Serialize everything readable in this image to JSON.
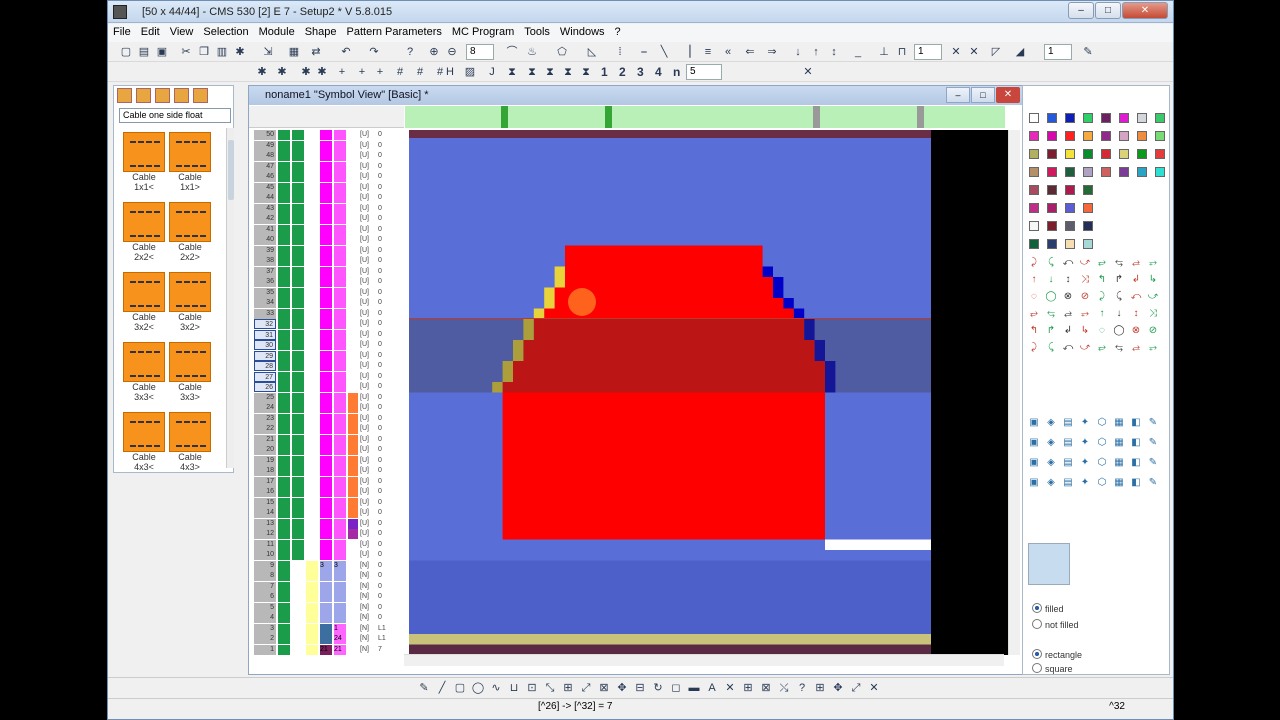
{
  "window": {
    "title": "[50 x 44/44] - CMS 530 [2] E 7 - Setup2 *    V 5.8.015",
    "min": "–",
    "max": "□",
    "close": "✕"
  },
  "menu": [
    "File",
    "Edit",
    "View",
    "Selection",
    "Module",
    "Shape",
    "Pattern Parameters",
    "MC Program",
    "Tools",
    "Windows",
    "?"
  ],
  "toolbar1": {
    "zoom": "8",
    "num": "1"
  },
  "toolbar2": {
    "labels": [
      "1",
      "2",
      "3",
      "4",
      "n"
    ],
    "num": "5"
  },
  "leftpanel": {
    "combo": "Cable one side float",
    "cables": [
      "Cable 1x1<",
      "Cable 1x1>",
      "Cable 2x2<",
      "Cable 2x2>",
      "Cable 3x2<",
      "Cable 3x2>",
      "Cable 3x3<",
      "Cable 3x3>",
      "Cable 4x3<",
      "Cable 4x3>"
    ]
  },
  "doc": {
    "title": "noname1 \"Symbol View\" [Basic] *",
    "ruler_marks": [
      "3",
      "2",
      "1",
      "0"
    ]
  },
  "rows": [
    {
      "n": "50",
      "t": "[U]",
      "z": "0"
    },
    {
      "n": "49",
      "t": "[U]",
      "z": "0"
    },
    {
      "n": "48",
      "t": "[U]",
      "z": "0"
    },
    {
      "n": "47",
      "t": "[U]",
      "z": "0"
    },
    {
      "n": "46",
      "t": "[U]",
      "z": "0"
    },
    {
      "n": "45",
      "t": "[U]",
      "z": "0"
    },
    {
      "n": "44",
      "t": "[U]",
      "z": "0"
    },
    {
      "n": "43",
      "t": "[U]",
      "z": "0"
    },
    {
      "n": "42",
      "t": "[U]",
      "z": "0"
    },
    {
      "n": "41",
      "t": "[U]",
      "z": "0"
    },
    {
      "n": "40",
      "t": "[U]",
      "z": "0"
    },
    {
      "n": "39",
      "t": "[U]",
      "z": "0"
    },
    {
      "n": "38",
      "t": "[U]",
      "z": "0"
    },
    {
      "n": "37",
      "t": "[U]",
      "z": "0"
    },
    {
      "n": "36",
      "t": "[U]",
      "z": "0"
    },
    {
      "n": "35",
      "t": "[U]",
      "z": "0"
    },
    {
      "n": "34",
      "t": "[U]",
      "z": "0"
    },
    {
      "n": "33",
      "t": "[U]",
      "z": "0"
    },
    {
      "n": "32",
      "t": "[U]",
      "z": "0"
    },
    {
      "n": "31",
      "t": "[U]",
      "z": "0"
    },
    {
      "n": "30",
      "t": "[U]",
      "z": "0"
    },
    {
      "n": "29",
      "t": "[U]",
      "z": "0"
    },
    {
      "n": "28",
      "t": "[U]",
      "z": "0"
    },
    {
      "n": "27",
      "t": "[U]",
      "z": "0"
    },
    {
      "n": "26",
      "t": "[U]",
      "z": "0"
    },
    {
      "n": "25",
      "t": "[U]",
      "z": "0"
    },
    {
      "n": "24",
      "t": "[U]",
      "z": "0"
    },
    {
      "n": "23",
      "t": "[U]",
      "z": "0"
    },
    {
      "n": "22",
      "t": "[U]",
      "z": "0"
    },
    {
      "n": "21",
      "t": "[U]",
      "z": "0"
    },
    {
      "n": "20",
      "t": "[U]",
      "z": "0"
    },
    {
      "n": "19",
      "t": "[U]",
      "z": "0"
    },
    {
      "n": "18",
      "t": "[U]",
      "z": "0"
    },
    {
      "n": "17",
      "t": "[U]",
      "z": "0"
    },
    {
      "n": "16",
      "t": "[U]",
      "z": "0"
    },
    {
      "n": "15",
      "t": "[U]",
      "z": "0"
    },
    {
      "n": "14",
      "t": "[U]",
      "z": "0"
    },
    {
      "n": "13",
      "t": "[U]",
      "z": "0"
    },
    {
      "n": "12",
      "t": "[U]",
      "z": "0"
    },
    {
      "n": "11",
      "t": "[U]",
      "z": "0"
    },
    {
      "n": "10",
      "t": "[U]",
      "z": "0"
    },
    {
      "n": "9",
      "t": "[N]",
      "z": "0"
    },
    {
      "n": "8",
      "t": "[N]",
      "z": "0"
    },
    {
      "n": "7",
      "t": "[N]",
      "z": "0"
    },
    {
      "n": "6",
      "t": "[N]",
      "z": "0"
    },
    {
      "n": "5",
      "t": "[N]",
      "z": "0"
    },
    {
      "n": "4",
      "t": "[N]",
      "z": "0"
    },
    {
      "n": "3",
      "t": "[N]",
      "z": "L1"
    },
    {
      "n": "2",
      "t": "[N]",
      "z": "L1"
    },
    {
      "n": "1",
      "t": "[N]",
      "z": "7"
    }
  ],
  "row_special": {
    "r3_c5": "1",
    "r2_c5": "24",
    "r1_c4": "21",
    "r1_c5": "21",
    "r9_c4": "3",
    "r9_c5": "3"
  },
  "colors": {
    "background": "#5a6ed8",
    "red": "#ff0000",
    "yellow": "#e8d33a",
    "darkblue": "#0000c8",
    "green": "#1a9c4a",
    "magenta": "#ff00ff"
  },
  "shape": {
    "filled": "filled",
    "not_filled": "not filled",
    "rectangle": "rectangle",
    "square": "square"
  },
  "status": {
    "left": "[^26] -> [^32] = 7",
    "right": "^32"
  }
}
